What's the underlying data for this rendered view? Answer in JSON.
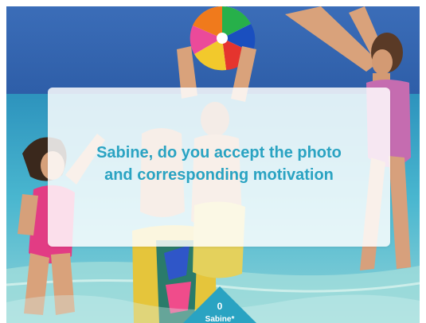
{
  "dialog": {
    "question_line1": "Sabine, do you accept the photo",
    "question_line2": "and corresponding motivation"
  },
  "player": {
    "score": "0",
    "name": "Sabine*"
  },
  "colors": {
    "accent": "#2aa3c2",
    "overlay": "#ffffff"
  },
  "icons": {
    "player_marker": "triangle-marker-icon"
  }
}
